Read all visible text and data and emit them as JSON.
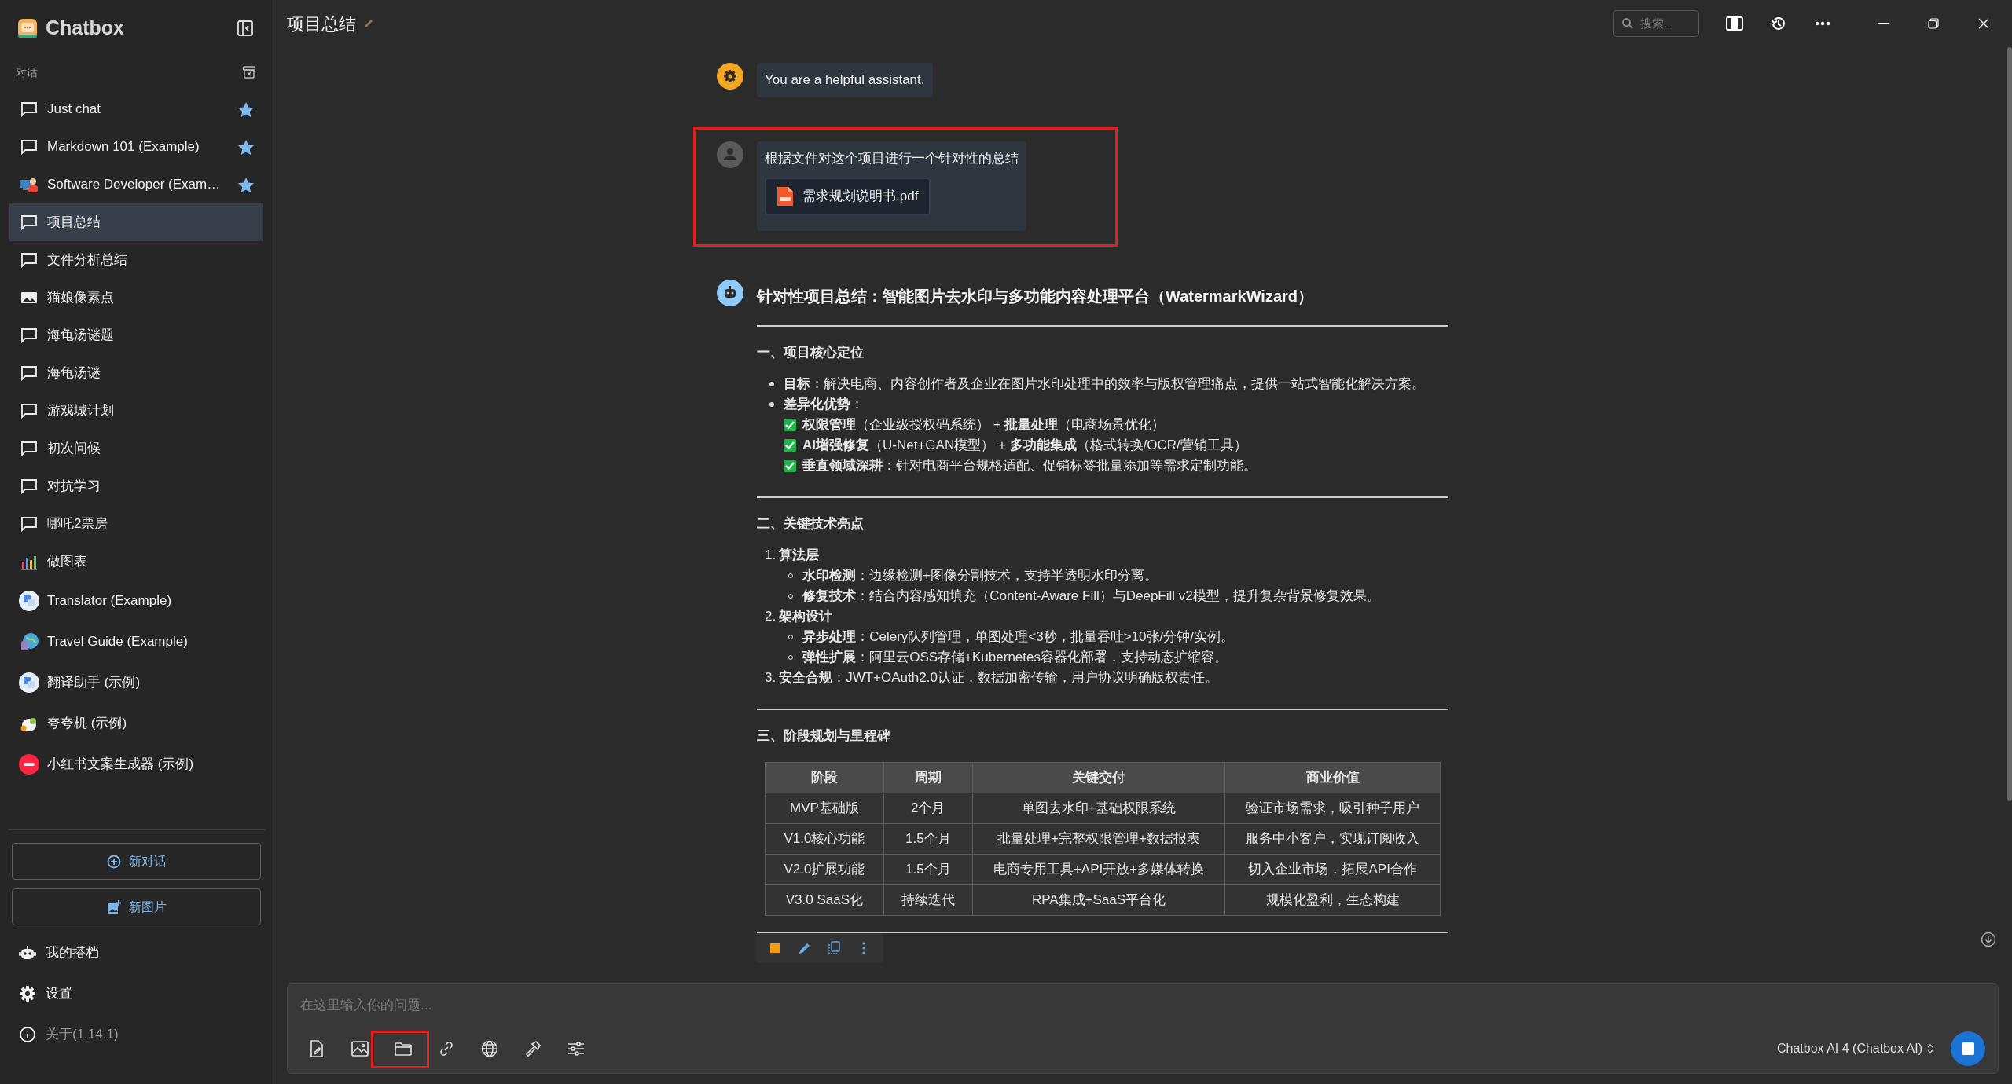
{
  "app": {
    "name": "Chatbox"
  },
  "sidebar": {
    "section_label": "对话",
    "items": [
      {
        "label": "Just chat",
        "kind": "chat",
        "starred": true,
        "selected": false
      },
      {
        "label": "Markdown 101 (Example)",
        "kind": "chat",
        "starred": true,
        "selected": false
      },
      {
        "label": "Software Developer (Exam…",
        "kind": "developer",
        "starred": true,
        "selected": false
      },
      {
        "label": "项目总结",
        "kind": "chat",
        "starred": false,
        "selected": true
      },
      {
        "label": "文件分析总结",
        "kind": "chat",
        "starred": false,
        "selected": false
      },
      {
        "label": "猫娘像素点",
        "kind": "image",
        "starred": false,
        "selected": false
      },
      {
        "label": "海龟汤谜题",
        "kind": "chat",
        "starred": false,
        "selected": false
      },
      {
        "label": "海龟汤谜",
        "kind": "chat",
        "starred": false,
        "selected": false
      },
      {
        "label": "游戏城计划",
        "kind": "chat",
        "starred": false,
        "selected": false
      },
      {
        "label": "初次问候",
        "kind": "chat",
        "starred": false,
        "selected": false
      },
      {
        "label": "对抗学习",
        "kind": "chat",
        "starred": false,
        "selected": false
      },
      {
        "label": "哪吒2票房",
        "kind": "chat",
        "starred": false,
        "selected": false
      },
      {
        "label": "做图表",
        "kind": "chart",
        "starred": false,
        "selected": false
      },
      {
        "label": "Translator (Example)",
        "kind": "translate",
        "starred": false,
        "selected": false
      },
      {
        "label": "Travel Guide (Example)",
        "kind": "globe",
        "starred": false,
        "selected": false
      },
      {
        "label": "翻译助手 (示例)",
        "kind": "translate",
        "starred": false,
        "selected": false
      },
      {
        "label": "夸夸机 (示例)",
        "kind": "mascot",
        "starred": false,
        "selected": false
      },
      {
        "label": "小红书文案生成器 (示例)",
        "kind": "redbook",
        "starred": false,
        "selected": false
      }
    ],
    "buttons": [
      {
        "label": "新对话",
        "kind": "plus"
      },
      {
        "label": "新图片",
        "kind": "image-add"
      }
    ],
    "footer": [
      {
        "label": "我的搭档",
        "kind": "bot",
        "muted": false
      },
      {
        "label": "设置",
        "kind": "gear",
        "muted": false
      },
      {
        "label": "关于(1.14.1)",
        "kind": "info",
        "muted": true
      }
    ]
  },
  "header": {
    "title": "项目总结",
    "search": {
      "placeholder": "搜索..."
    }
  },
  "messages": [
    {
      "kind": "system",
      "text": "You are a helpful assistant."
    },
    {
      "kind": "user",
      "text": "根据文件对这个项目进行一个针对性的总结",
      "attachments": [
        {
          "name": "需求规划说明书.pdf"
        }
      ]
    },
    {
      "kind": "assistant",
      "title": "针对性项目总结：智能图片去水印与多功能内容处理平台（WatermarkWizard）",
      "blocks": [
        {
          "kind": "rule"
        },
        {
          "kind": "heading",
          "text": "一、项目核心定位"
        },
        {
          "kind": "bullets",
          "items": [
            {
              "text": "**目标**：解决电商、内容创作者及企业在图片水印处理中的效率与版权管理痛点，提供一站式智能化解决方案。"
            },
            {
              "text": "**差异化优势**：",
              "checks": [
                {
                  "text": "**权限管理**（企业级授权码系统） + **批量处理**（电商场景优化）",
                  "checked": true
                },
                {
                  "text": "**AI增强修复**（U-Net+GAN模型） + **多功能集成**（格式转换/OCR/营销工具）",
                  "checked": true
                },
                {
                  "text": "**垂直领域深耕**：针对电商平台规格适配、促销标签批量添加等需求定制功能。",
                  "checked": true
                }
              ]
            }
          ]
        },
        {
          "kind": "rule"
        },
        {
          "kind": "heading",
          "text": "二、关键技术亮点"
        },
        {
          "kind": "numbered",
          "items": [
            {
              "marker": "1.",
              "text": "**算法层**",
              "children": [
                {
                  "text": "**水印检测**：边缘检测+图像分割技术，支持半透明水印分离。"
                },
                {
                  "text": "**修复技术**：结合内容感知填充（Content-Aware Fill）与DeepFill v2模型，提升复杂背景修复效果。"
                }
              ]
            },
            {
              "marker": "2.",
              "text": "**架构设计**",
              "children": [
                {
                  "text": "**异步处理**：Celery队列管理，单图处理<3秒，批量吞吐>10张/分钟/实例。"
                },
                {
                  "text": "**弹性扩展**：阿里云OSS存储+Kubernetes容器化部署，支持动态扩缩容。"
                }
              ]
            },
            {
              "marker": "3.",
              "text": "**安全合规**：JWT+OAuth2.0认证，数据加密传输，用户协议明确版权责任。"
            }
          ]
        },
        {
          "kind": "rule"
        },
        {
          "kind": "heading",
          "text": "三、阶段规划与里程碑"
        },
        {
          "kind": "table",
          "columns": [
            "阶段",
            "周期",
            "关键交付",
            "商业价值"
          ],
          "rows": [
            [
              "MVP基础版",
              "2个月",
              "单图去水印+基础权限系统",
              "验证市场需求，吸引种子用户"
            ],
            [
              "V1.0核心功能",
              "1.5个月",
              "批量处理+完整权限管理+数据报表",
              "服务中小客户，实现订阅收入"
            ],
            [
              "V2.0扩展功能",
              "1.5个月",
              "电商专用工具+API开放+多媒体转换",
              "切入企业市场，拓展API合作"
            ],
            [
              "V3.0 SaaS化",
              "持续迭代",
              "RPA集成+SaaS平台化",
              "规模化盈利，生态构建"
            ]
          ]
        },
        {
          "kind": "rule"
        }
      ]
    }
  ],
  "composer": {
    "placeholder": "在这里输入你的问题...",
    "model": "Chatbox AI 4 (Chatbox AI)"
  }
}
